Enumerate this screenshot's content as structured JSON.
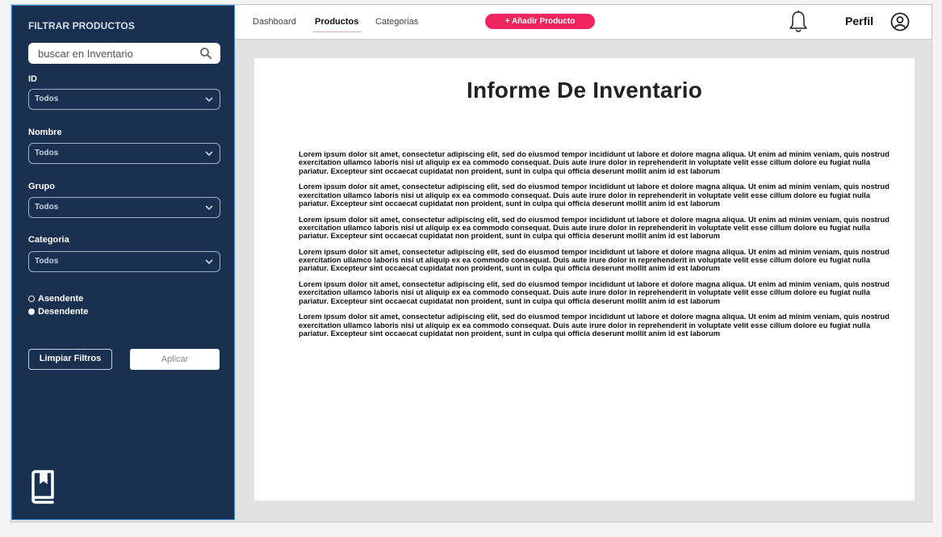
{
  "sidebar": {
    "title": "FILTRAR PRODUCTOS",
    "search_placeholder": "buscar en Inventario",
    "filters": [
      {
        "label": "ID",
        "value": "Todos"
      },
      {
        "label": "Nombre",
        "value": "Todos"
      },
      {
        "label": "Grupo",
        "value": "Todos"
      },
      {
        "label": "Categoria",
        "value": "Todos"
      }
    ],
    "sort_options": [
      {
        "label": "Asendente",
        "selected": false
      },
      {
        "label": "Desendente",
        "selected": true
      }
    ],
    "clear_label": "Limpiar Filtros",
    "apply_label": "Aplicar"
  },
  "topbar": {
    "nav": [
      "Dashboard",
      "Productos",
      "Categorias"
    ],
    "active_nav": "Productos",
    "add_button": "+ Añadir Producto",
    "profile_label": "Perfil"
  },
  "report": {
    "title": "Informe De Inventario",
    "paragraphs": [
      "Lorem ipsum dolor sit amet, consectetur adipiscing elit, sed do eiusmod tempor incididunt ut labore et dolore magna aliqua. Ut enim ad minim veniam, quis nostrud exercitation ullamco laboris nisi ut aliquip ex ea commodo consequat. Duis aute irure dolor in reprehenderit in voluptate velit esse cillum dolore eu fugiat nulla pariatur. Excepteur sint occaecat cupidatat non proident, sunt in culpa qui officia deserunt mollit anim id est laborum",
      "Lorem ipsum dolor sit amet, consectetur adipiscing elit, sed do eiusmod tempor incididunt ut labore et dolore magna aliqua. Ut enim ad minim veniam, quis nostrud exercitation ullamco laboris nisi ut aliquip ex ea commodo consequat. Duis aute irure dolor in reprehenderit in voluptate velit esse cillum dolore eu fugiat nulla pariatur. Excepteur sint occaecat cupidatat non proident, sunt in culpa qui officia deserunt mollit anim id est laborum",
      "Lorem ipsum dolor sit amet, consectetur adipiscing elit, sed do eiusmod tempor incididunt ut labore et dolore magna aliqua. Ut enim ad minim veniam, quis nostrud exercitation ullamco laboris nisi ut aliquip ex ea commodo consequat. Duis aute irure dolor in reprehenderit in voluptate velit esse cillum dolore eu fugiat nulla pariatur. Excepteur sint occaecat cupidatat non proident, sunt in culpa qui officia deserunt mollit anim id est laborum",
      "Lorem ipsum dolor sit amet, consectetur adipiscing elit, sed do eiusmod tempor incididunt ut labore et dolore magna aliqua. Ut enim ad minim veniam, quis nostrud exercitation ullamco laboris nisi ut aliquip ex ea commodo consequat. Duis aute irure dolor in reprehenderit in voluptate velit esse cillum dolore eu fugiat nulla pariatur. Excepteur sint occaecat cupidatat non proident, sunt in culpa qui officia deserunt mollit anim id est laborum",
      "Lorem ipsum dolor sit amet, consectetur adipiscing elit, sed do eiusmod tempor incididunt ut labore et dolore magna aliqua. Ut enim ad minim veniam, quis nostrud exercitation ullamco laboris nisi ut aliquip ex ea commodo consequat. Duis aute irure dolor in reprehenderit in voluptate velit esse cillum dolore eu fugiat nulla pariatur. Excepteur sint occaecat cupidatat non proident, sunt in culpa qui officia deserunt mollit anim id est laborum",
      "Lorem ipsum dolor sit amet, consectetur adipiscing elit, sed do eiusmod tempor incididunt ut labore et dolore magna aliqua. Ut enim ad minim veniam, quis nostrud exercitation ullamco laboris nisi ut aliquip ex ea commodo consequat. Duis aute irure dolor in reprehenderit in voluptate velit esse cillum dolore eu fugiat nulla pariatur. Excepteur sint occaecat cupidatat non proident, sunt in culpa qui officia deserunt mollit anim id est laborum"
    ]
  },
  "colors": {
    "sidebar_bg": "#1a3050",
    "accent": "#f0245e",
    "page_bg": "#e2e2e2"
  },
  "icons": [
    "search-icon",
    "chevron-down-icon",
    "book-icon",
    "bell-icon",
    "user-icon"
  ]
}
